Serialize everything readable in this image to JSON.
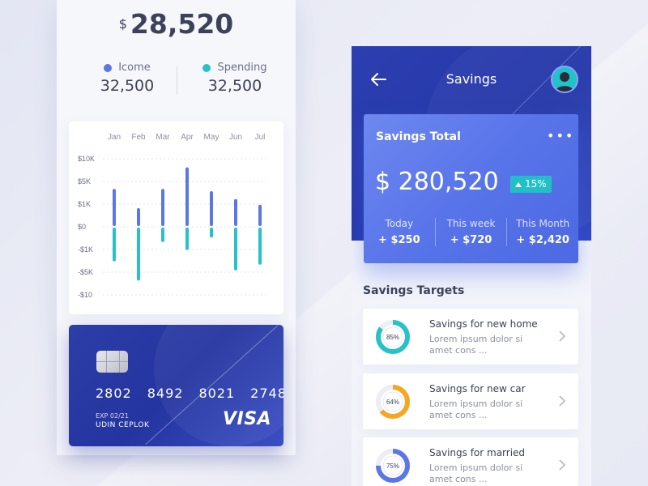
{
  "left_phone": {
    "balance": {
      "currency": "$",
      "amount": "28,520"
    },
    "income": {
      "label": "Icome",
      "value": "32,500",
      "color": "#5b77e6"
    },
    "spending": {
      "label": "Spending",
      "value": "32,500",
      "color": "#27c1c8"
    },
    "chart": {
      "months": [
        "Jan",
        "Feb",
        "Mar",
        "Apr",
        "May",
        "Jun",
        "Jul"
      ],
      "y_ticks": [
        "$10K",
        "$5K",
        "$1K",
        "$0",
        "-$1K",
        "-$5K",
        "-$10"
      ]
    },
    "card": {
      "number_groups": [
        "2802",
        "8492",
        "8021",
        "2748"
      ],
      "expiry": "EXP 02/21",
      "holder": "UDIN CEPLOK",
      "brand": "VISA"
    }
  },
  "chart_data": {
    "type": "bar",
    "categories": [
      "Jan",
      "Feb",
      "Mar",
      "Apr",
      "May",
      "Jun",
      "Jul"
    ],
    "y_axis_ticks": [
      "$10K",
      "$5K",
      "$1K",
      "$0",
      "-$1K",
      "-$5K",
      "-$10"
    ],
    "y_axis_scale": "ordinal (tick index: 3 = $10K, 2 = $5K, 1 = $1K, 0 = $0, -1 = -$1K, -2 = -$5K, -3 = -$10)",
    "ylim": [
      -3,
      3
    ],
    "grid": true,
    "series": [
      {
        "name": "Icome",
        "color": "#5b77e6",
        "values": [
          1.6,
          0.75,
          1.6,
          2.55,
          1.5,
          1.15,
          0.9
        ]
      },
      {
        "name": "Spending",
        "color": "#27c1c8",
        "values": [
          -1.45,
          -2.3,
          -0.6,
          -0.95,
          -0.4,
          -1.85,
          -1.6
        ]
      }
    ]
  },
  "right_phone": {
    "header": {
      "title": "Savings"
    },
    "savings_card": {
      "title": "Savings Total",
      "more": "•••",
      "amount": "$ 280,520",
      "badge": "15%",
      "periods": [
        {
          "label": "Today",
          "value": "+ $250"
        },
        {
          "label": "This week",
          "value": "+ $720"
        },
        {
          "label": "This Month",
          "value": "+ $2,420"
        }
      ]
    },
    "targets_title": "Savings Targets",
    "targets": [
      {
        "name": "Savings for new home",
        "desc": "Lorem ipsum dolor si amet cons ...",
        "percent": 85,
        "percent_label": "85%",
        "color": "#27c1c8"
      },
      {
        "name": "Savings for new car",
        "desc": "Lorem ipsum dolor si amet cons ...",
        "percent": 64,
        "percent_label": "64%",
        "color": "#f5a623"
      },
      {
        "name": "Savings for married",
        "desc": "Lorem ipsum dolor si amet cons ...",
        "percent": 75,
        "percent_label": "75%",
        "color": "#5b77e6"
      }
    ]
  }
}
